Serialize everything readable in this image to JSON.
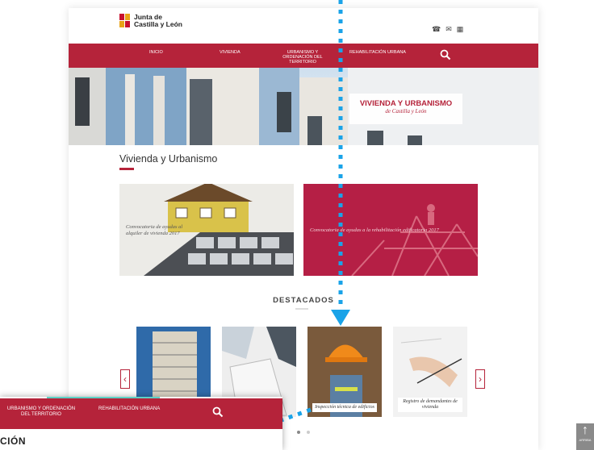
{
  "header": {
    "logo_line1": "Junta de",
    "logo_line2": "Castilla y León"
  },
  "top_icons": [
    "phone-icon",
    "mail-icon",
    "grid-icon"
  ],
  "nav": {
    "items": [
      {
        "label": "INICIO"
      },
      {
        "label": "VIVIENDA"
      },
      {
        "label": "URBANISMO Y ORDENACIÓN DEL TERRITORIO"
      },
      {
        "label": "REHABILITACIÓN URBANA"
      }
    ],
    "search_icon": "search-icon"
  },
  "hero": {
    "title": "VIVIENDA Y URBANISMO",
    "subtitle": "de Castilla y León"
  },
  "section": {
    "title": "Vivienda y Urbanismo"
  },
  "promos": [
    {
      "text": "Convocatoria de ayudas al alquiler de vivienda 2017"
    },
    {
      "text": "Convocatoria de ayudas a la rehabilitación edificatoria 2017"
    }
  ],
  "destacados": {
    "title": "DESTACADOS",
    "cards": [
      {
        "label": ""
      },
      {
        "label": ""
      },
      {
        "label": "Inspección técnica de edificios"
      },
      {
        "label": "Registro de demandantes de vivienda"
      }
    ],
    "prev": "‹",
    "next": "›"
  },
  "zoom_panel": {
    "items": [
      {
        "label": "URBANISMO Y ORDENACIÓN DEL TERRITORIO"
      },
      {
        "label": "REHABILITACIÓN URBANA"
      }
    ],
    "heading": "CIÓN"
  },
  "back_to_top": {
    "label": "ARRIBA"
  },
  "colors": {
    "brand_red": "#b5233a",
    "annotation_blue": "#1aa3e8"
  }
}
